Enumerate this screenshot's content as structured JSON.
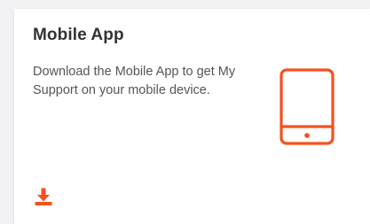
{
  "card": {
    "title": "Mobile App",
    "description": "Download the Mobile App to get My Support on your mobile device.",
    "icon": "mobile-phone-icon",
    "action_icon": "download-icon"
  },
  "colors": {
    "accent": "#f4511e",
    "background": "#f2f2f4",
    "card": "#ffffff",
    "title": "#333333",
    "text": "#555555"
  }
}
